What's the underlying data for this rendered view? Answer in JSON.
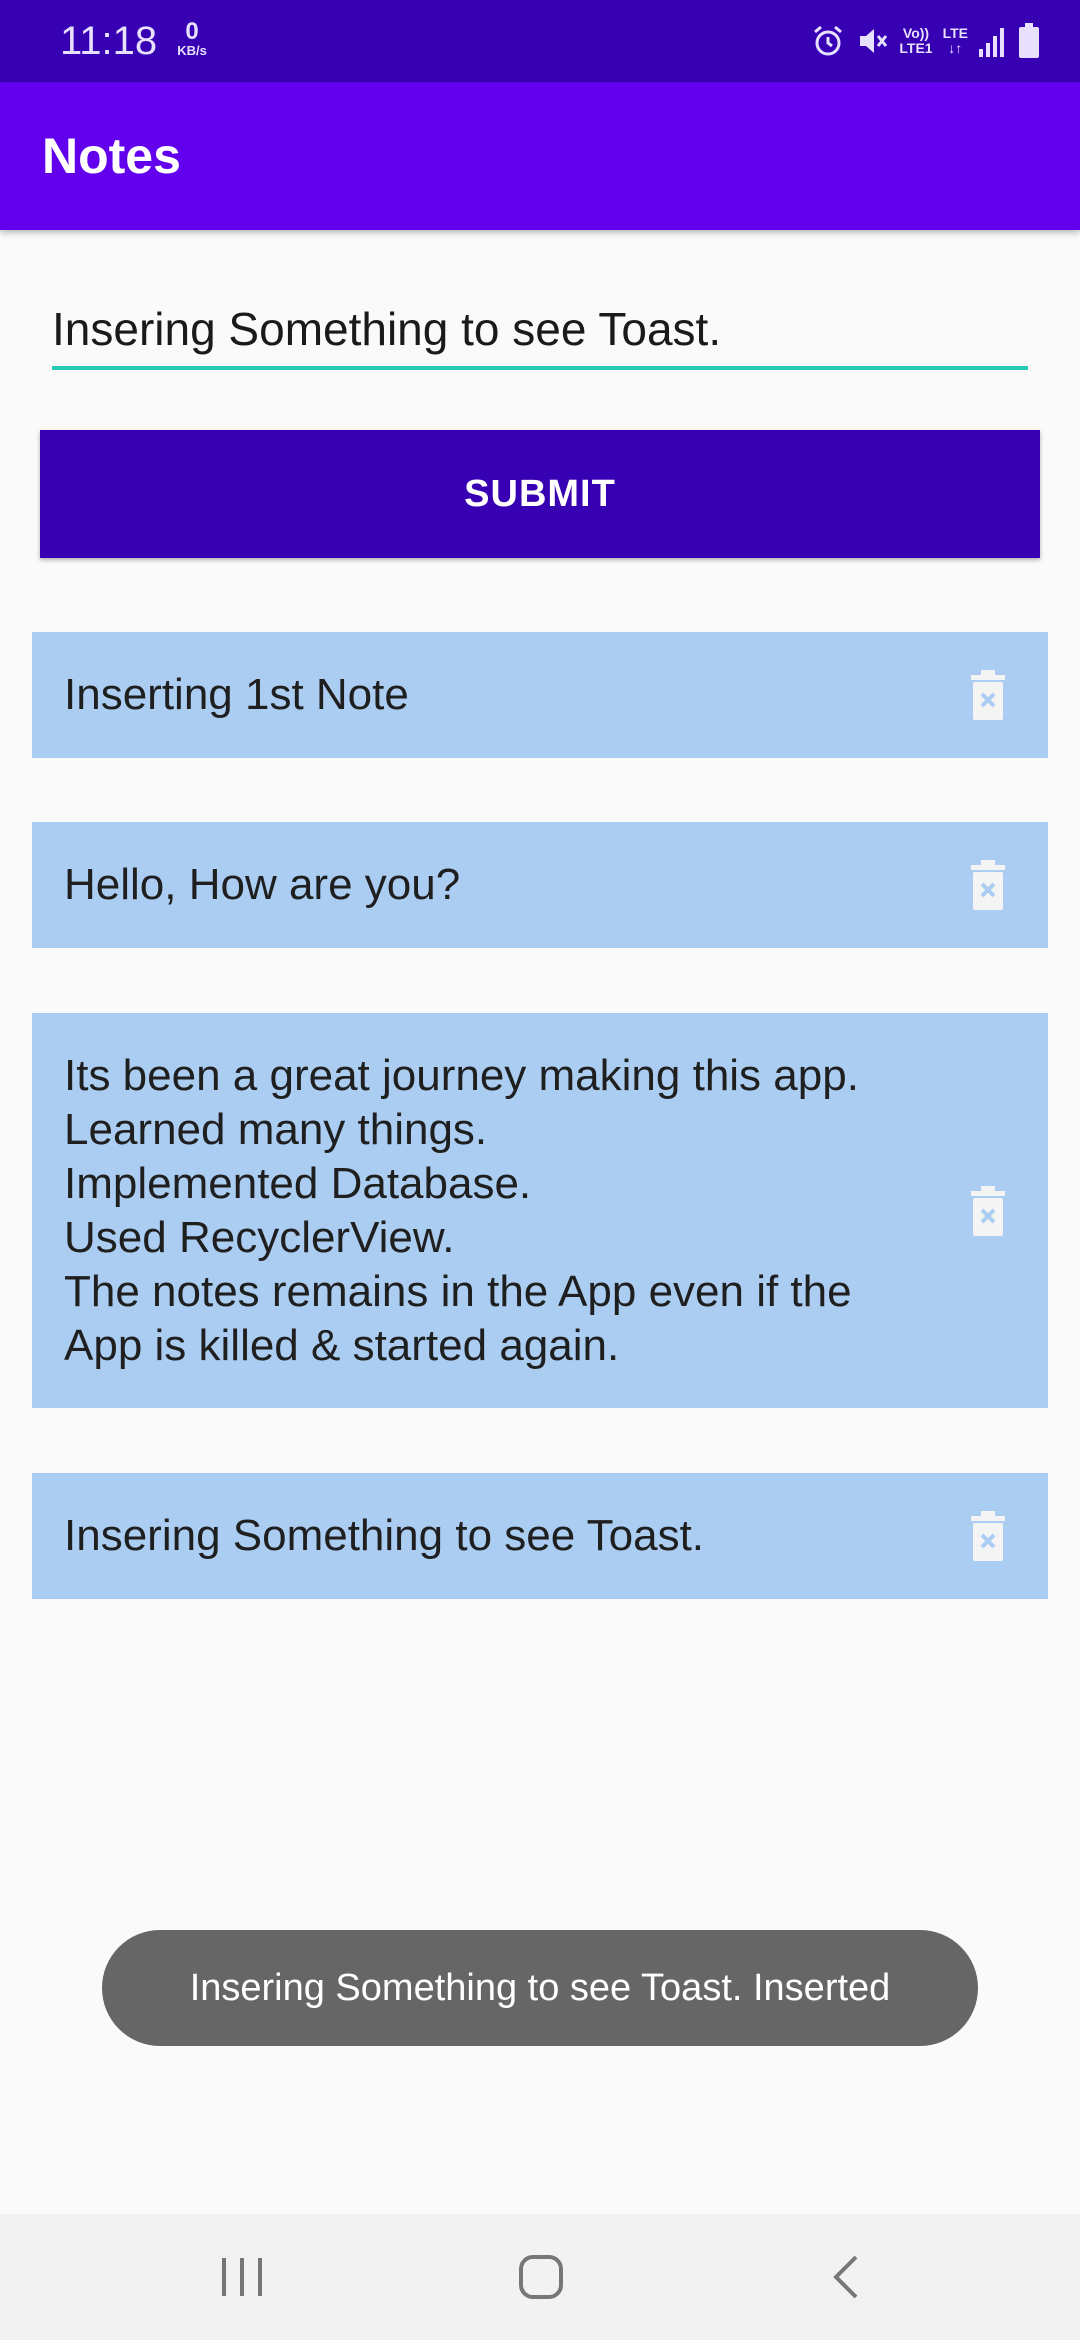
{
  "status_bar": {
    "time": "11:18",
    "speed_value": "0",
    "speed_unit": "KB/s",
    "volte": "Vo))",
    "lte_top": "LTE",
    "lte_line1": "LTE1",
    "icons": [
      "alarm-icon",
      "mute-icon",
      "signal-icon",
      "battery-icon"
    ]
  },
  "app_bar": {
    "title": "Notes"
  },
  "note_input": {
    "value": "Insering Something to see Toast."
  },
  "submit_button": {
    "label": "SUBMIT"
  },
  "notes": [
    {
      "text": "Inserting 1st Note"
    },
    {
      "text": "Hello, How are you?"
    },
    {
      "text": "Its been a great journey making this app.\nLearned many things.\nImplemented Database.\nUsed RecyclerView.\nThe notes remains in the App even if the App is killed & started again."
    },
    {
      "text": "Insering Something to see Toast."
    }
  ],
  "toast": {
    "message": "Insering Something to see Toast. Inserted"
  },
  "nav_bar": {
    "buttons": [
      "recents-icon",
      "home-icon",
      "back-icon"
    ]
  },
  "colors": {
    "status_bar": "#3700b3",
    "app_bar": "#6200ee",
    "accent": "#2ac9b6",
    "button": "#3700b3",
    "card": "#abcdf2",
    "toast": "#666666"
  }
}
